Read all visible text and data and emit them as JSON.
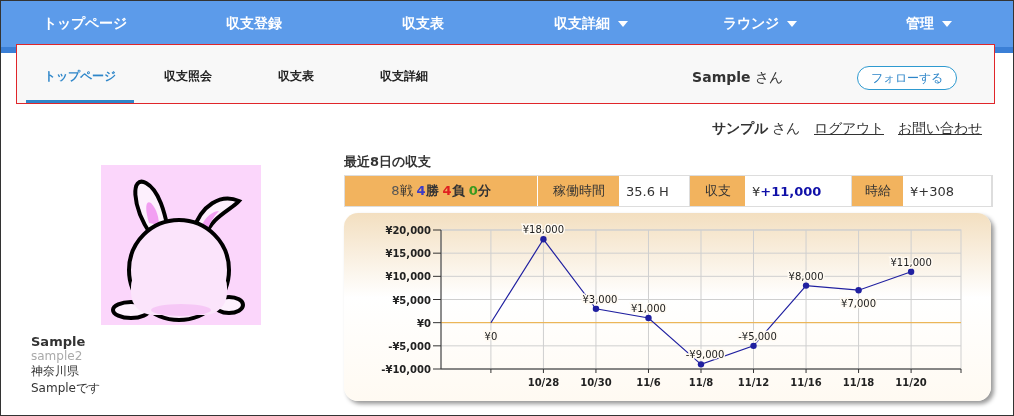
{
  "main_nav": [
    {
      "label": "トップページ",
      "dropdown": false
    },
    {
      "label": "収支登録",
      "dropdown": false
    },
    {
      "label": "収支表",
      "dropdown": false
    },
    {
      "label": "収支詳細",
      "dropdown": true
    },
    {
      "label": "ラウンジ",
      "dropdown": true
    },
    {
      "label": "管理",
      "dropdown": true
    }
  ],
  "sub_nav": {
    "tabs": [
      {
        "label": "トップページ",
        "selected": true
      },
      {
        "label": "収支照会",
        "selected": false
      },
      {
        "label": "収支表",
        "selected": false
      },
      {
        "label": "収支詳細",
        "selected": false
      }
    ],
    "user": "**Sample** さん",
    "follow_button": "フォローする",
    "highlighted": true
  },
  "user_bar": {
    "greeting": "**サンプル** さん",
    "links": [
      "ログアウト",
      "お問い合わせ"
    ]
  },
  "profile": {
    "name": "Sample",
    "id": "sample2",
    "location": "神奈川県",
    "bio": "Sampleです"
  },
  "summary": {
    "title": "最近8日の収支",
    "record": [
      {
        "number": "8",
        "unit": "戦",
        "color": "#555555",
        "bold": false
      },
      {
        "number": "4",
        "unit": "勝",
        "color": "#3b3bc8",
        "bold": true
      },
      {
        "number": "4",
        "unit": "負",
        "color": "#e02020",
        "bold": true
      },
      {
        "number": "0",
        "unit": "分",
        "color": "#3a9a20",
        "bold": true
      }
    ],
    "stats": [
      {
        "label": "稼働時間",
        "value": "35.6 H"
      },
      {
        "label": "収支",
        "value": "¥**+11,000**"
      },
      {
        "label": "時給",
        "value": "¥+308"
      }
    ],
    "chart_data": {
      "type": "line",
      "categories": [
        null,
        "10/28",
        "10/30",
        "11/6",
        "11/8",
        "11/12",
        "11/16",
        "11/18",
        "11/20"
      ],
      "series": [
        {
          "color": "#2020a0",
          "marker": "circle",
          "values": [
            0,
            18000,
            3000,
            1000,
            -9000,
            -5000,
            8000,
            7000,
            11000
          ]
        }
      ],
      "grid": true,
      "ref_lines": [
        {
          "axis": "y",
          "value": 0,
          "color": "#f0b040"
        }
      ],
      "ylim": [
        -10000,
        20000
      ],
      "yticks": [
        {
          "value": 20000,
          "label": "¥20,000"
        },
        {
          "value": 15000,
          "label": "¥15,000"
        },
        {
          "value": 10000,
          "label": "¥10,000"
        },
        {
          "value": 5000,
          "label": "¥5,000"
        },
        {
          "value": 0,
          "label": "¥0"
        },
        {
          "value": -5000,
          "label": "-¥5,000"
        },
        {
          "value": -10000,
          "label": "-¥10,000"
        }
      ],
      "value_labels": [
        "¥0",
        "¥18,000",
        "¥3,000",
        "¥1,000",
        "-¥9,000",
        "-¥5,000",
        "¥8,000",
        "¥7,000",
        "¥11,000"
      ]
    }
  }
}
